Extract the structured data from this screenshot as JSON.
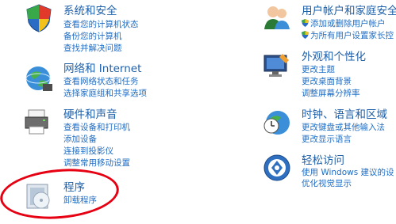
{
  "left": [
    {
      "title": "系统和安全",
      "links": [
        "查看您的计算机状态",
        "备份您的计算机",
        "查找并解决问题"
      ]
    },
    {
      "title": "网络和 Internet",
      "links": [
        "查看网络状态和任务",
        "选择家庭组和共享选项"
      ]
    },
    {
      "title": "硬件和声音",
      "links": [
        "查看设备和打印机",
        "添加设备",
        "连接到投影仪",
        "调整常用移动设置"
      ]
    },
    {
      "title": "程序",
      "links": [
        "卸载程序"
      ]
    }
  ],
  "right": [
    {
      "title": "用户帐户和家庭安全",
      "links": [
        "添加或删除用户帐户",
        "为所有用户设置家长控"
      ],
      "shields": [
        true,
        true
      ]
    },
    {
      "title": "外观和个性化",
      "links": [
        "更改主题",
        "更改桌面背景",
        "调整屏幕分辨率"
      ]
    },
    {
      "title": "时钟、语言和区域",
      "links": [
        "更改键盘或其他输入法",
        "更改显示语言"
      ]
    },
    {
      "title": "轻松访问",
      "links": [
        "使用 Windows 建议的设",
        "优化视觉显示"
      ]
    }
  ]
}
